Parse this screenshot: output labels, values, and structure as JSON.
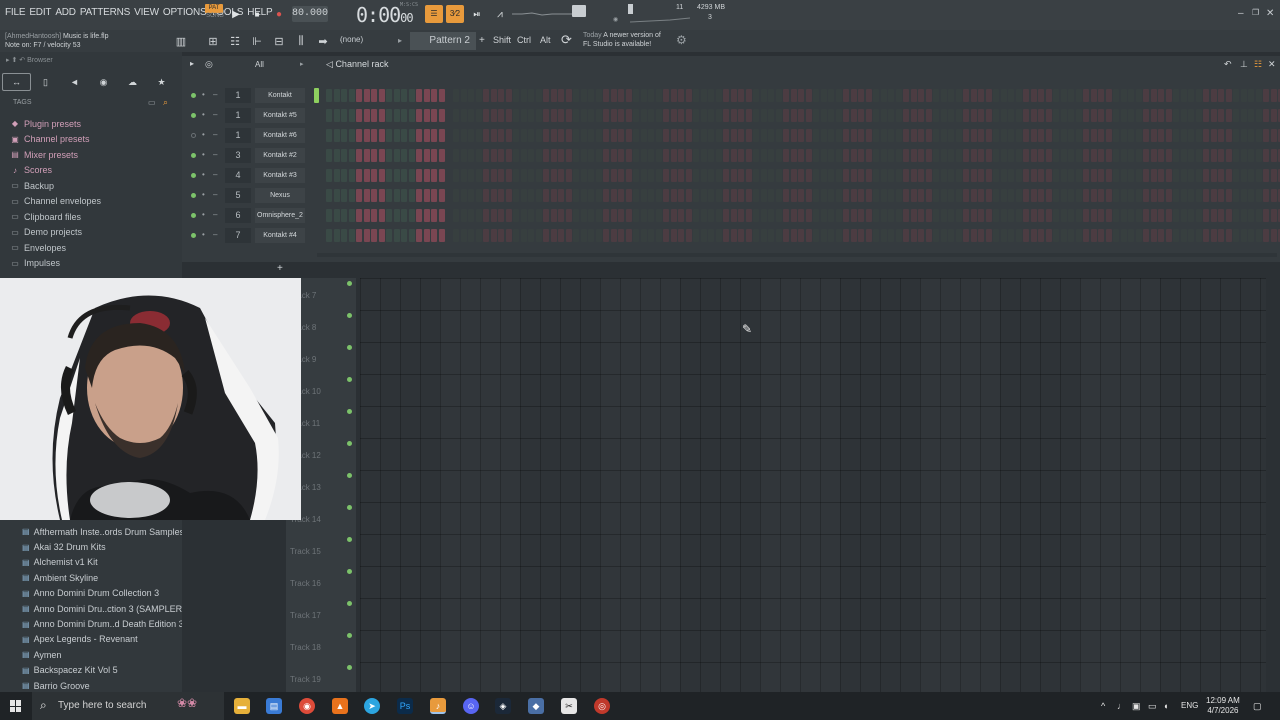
{
  "menu": [
    "FILE",
    "EDIT",
    "ADD",
    "PATTERNS",
    "VIEW",
    "OPTIONS",
    "TOOLS",
    "HELP"
  ],
  "transport": {
    "pat_label": "PAT",
    "song_label": "SONG",
    "tempo": "80.000",
    "time_main": "0:00",
    "time_ms": "00",
    "time_unit": "M:S:CS"
  },
  "meters": {
    "cpu": "11",
    "memory": "4293 MB",
    "polyphony": "3"
  },
  "project": {
    "user": "[AhmedHantoosh]",
    "file": "Music is life.flp"
  },
  "hint": "Note on: F7 / velocity 53",
  "pattern": {
    "none_label": "(none)",
    "current": "Pattern 2"
  },
  "modkeys": [
    "Shift",
    "Ctrl",
    "Alt"
  ],
  "news": {
    "today": "Today",
    "line1": "A newer version of",
    "line2": "FL Studio is available!"
  },
  "browser": {
    "title": "Browser",
    "tags_label": "TAGS",
    "items": [
      {
        "label": "Plugin presets",
        "icon": "plugin-icon",
        "pink": true
      },
      {
        "label": "Channel presets",
        "icon": "channel-icon",
        "pink": true
      },
      {
        "label": "Mixer presets",
        "icon": "mixer-icon",
        "pink": true
      },
      {
        "label": "Scores",
        "icon": "note-icon",
        "pink": true
      },
      {
        "label": "Backup",
        "icon": "folder-icon",
        "pink": false
      },
      {
        "label": "Channel envelopes",
        "icon": "folder-icon",
        "pink": false
      },
      {
        "label": "Clipboard files",
        "icon": "folder-icon",
        "pink": false
      },
      {
        "label": "Demo projects",
        "icon": "folder-icon",
        "pink": false
      },
      {
        "label": "Envelopes",
        "icon": "folder-icon",
        "pink": false
      },
      {
        "label": "Impulses",
        "icon": "folder-icon",
        "pink": false
      }
    ],
    "packs": [
      "Afthermath Inste..ords Drum Samples",
      "Akai 32 Drum Kits",
      "Alchemist v1 Kit",
      "Ambient Skyline",
      "Anno Domini Drum Collection 3",
      "Anno Domini Dru..ction 3 (SAMPLER)",
      "Anno Domini Drum..d Death Edition 3",
      "Apex Legends - Revenant",
      "Aymen",
      "Backspacez Kit Vol 5",
      "Barrio Groove"
    ]
  },
  "channel_rack": {
    "title": "Channel rack",
    "filter": "All",
    "channels": [
      {
        "name": "Kontakt",
        "mixer": "1",
        "on": true
      },
      {
        "name": "Kontakt #5",
        "mixer": "1",
        "on": true
      },
      {
        "name": "Kontakt #6",
        "mixer": "1",
        "on": false
      },
      {
        "name": "Kontakt #2",
        "mixer": "3",
        "on": true
      },
      {
        "name": "Kontakt #3",
        "mixer": "4",
        "on": true
      },
      {
        "name": "Nexus",
        "mixer": "5",
        "on": true
      },
      {
        "name": "Omnisphere_2",
        "mixer": "6",
        "on": true
      },
      {
        "name": "Kontakt #4",
        "mixer": "7",
        "on": true
      }
    ],
    "add_label": "+"
  },
  "playlist": {
    "tracks": [
      "Track 7",
      "Track 8",
      "Track 9",
      "Track 10",
      "Track 11",
      "Track 12",
      "Track 13",
      "Track 14",
      "Track 15",
      "Track 16",
      "Track 17",
      "Track 18",
      "Track 19"
    ]
  },
  "taskbar": {
    "search_placeholder": "Type here to search",
    "language": "ENG",
    "time": "12:09 AM",
    "date": "4/7/2026"
  },
  "colors": {
    "accent": "#e89a3c",
    "led_on": "#7cc26a",
    "step_red": "#7a4652",
    "step_green": "#3a4a46"
  }
}
